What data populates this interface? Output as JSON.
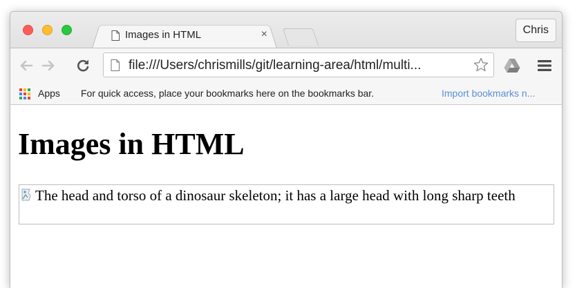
{
  "window": {
    "tab": {
      "title": "Images in HTML",
      "close_glyph": "×",
      "icon": "page-icon"
    },
    "profile_label": "Chris"
  },
  "toolbar": {
    "back_icon": "back-arrow-icon",
    "forward_icon": "forward-arrow-icon",
    "reload_icon": "reload-icon",
    "url": "file:///Users/chrismills/git/learning-area/html/multi...",
    "bookmark_star_icon": "star-icon",
    "extension_icon": "google-drive-icon",
    "menu_icon": "hamburger-menu-icon"
  },
  "bookmarks": {
    "apps_label": "Apps",
    "hint": "For quick access, place your bookmarks here on the bookmarks bar.",
    "import_link": "Import bookmarks n..."
  },
  "page": {
    "heading": "Images in HTML",
    "image_alt": "The head and torso of a dinosaur skeleton; it has a large head with long sharp teeth"
  },
  "colors": {
    "close": "#fc5f57",
    "minimize": "#fdbd2e",
    "maximize": "#28c940",
    "link_blue": "#5a8fd8"
  }
}
